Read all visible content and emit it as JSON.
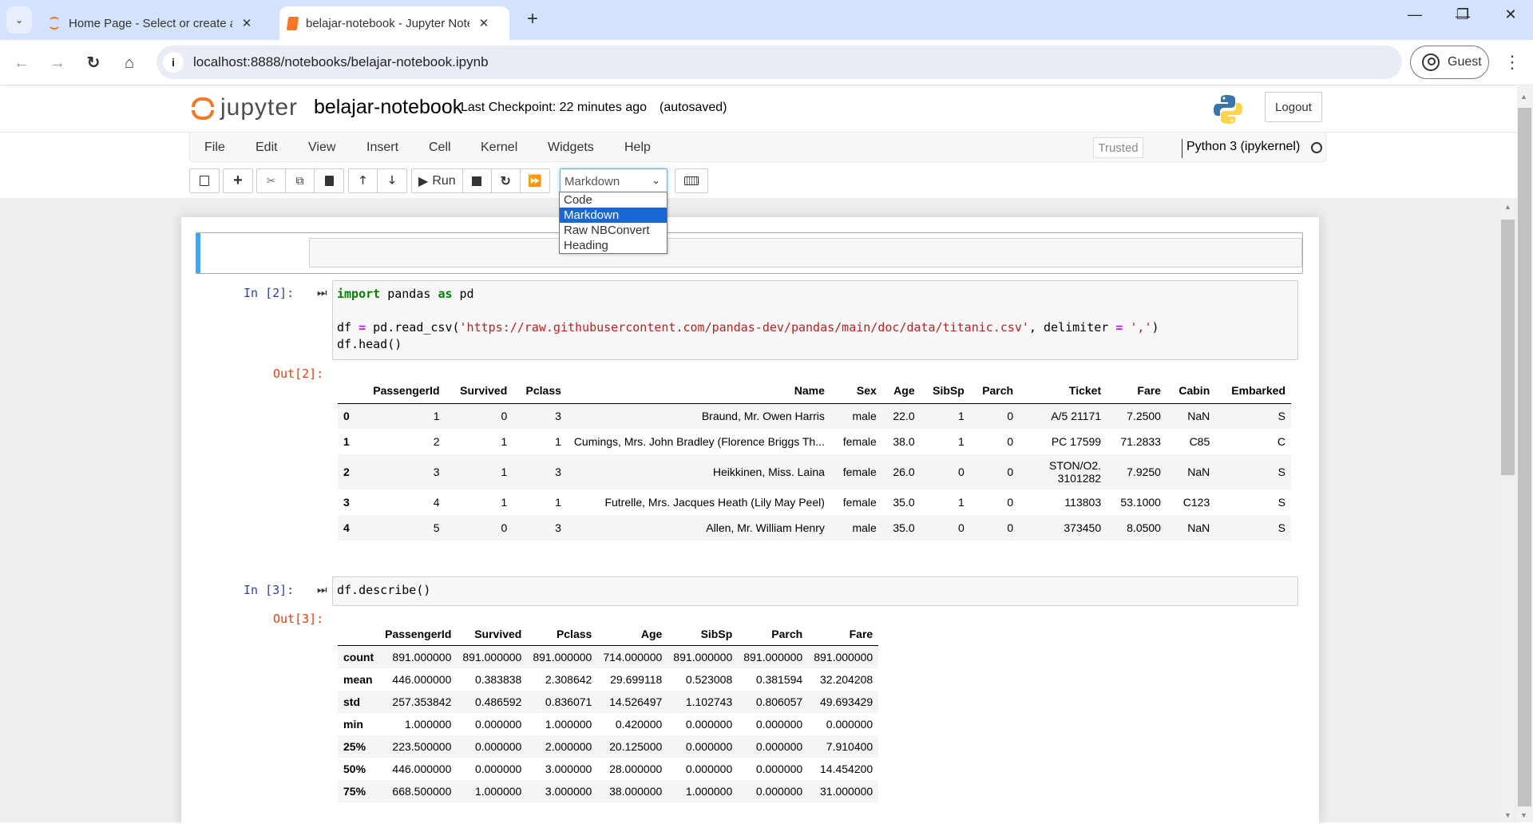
{
  "browser": {
    "tabs": [
      {
        "title": "Home Page - Select or create a notebook",
        "icon": "jupyter-logo-icon",
        "active": false
      },
      {
        "title": "belajar-notebook - Jupyter Notebook",
        "icon": "notebook-icon",
        "active": true
      }
    ],
    "new_tab": "+",
    "url": "localhost:8888/notebooks/belajar-notebook.ipynb",
    "profile_label": "Guest",
    "window_controls": {
      "minimize": "—",
      "restore": "❐",
      "close": "✕"
    }
  },
  "jupyter": {
    "logo_text": "jupyter",
    "notebook_name": "belajar-notebook",
    "checkpoint": "Last Checkpoint: 22 minutes ago",
    "autosave_status": "(autosaved)",
    "logout_label": "Logout",
    "menu": [
      "File",
      "Edit",
      "View",
      "Insert",
      "Cell",
      "Kernel",
      "Widgets",
      "Help"
    ],
    "trusted_label": "Trusted",
    "kernel_name": "Python 3 (ipykernel)",
    "toolbar": {
      "run_label": "Run",
      "cell_type_selected": "Markdown",
      "cell_type_options": [
        "Code",
        "Markdown",
        "Raw NBConvert",
        "Heading"
      ]
    }
  },
  "cells": [
    {
      "type": "markdown",
      "content": ""
    },
    {
      "type": "code",
      "prompt_in": "In [2]:",
      "prompt_out": "Out[2]:",
      "code_line1_kw1": "import",
      "code_line1_mid": " pandas ",
      "code_line1_kw2": "as",
      "code_line1_end": " pd",
      "code_line3_a": "df ",
      "code_line3_eq": "=",
      "code_line3_b": " pd.read_csv(",
      "code_line3_str": "'https://raw.githubusercontent.com/pandas-dev/pandas/main/doc/data/titanic.csv'",
      "code_line3_c": ", delimiter ",
      "code_line3_eq2": "=",
      "code_line3_d": " ",
      "code_line3_str2": "','",
      "code_line3_e": ")",
      "code_line4": "df.head()",
      "table": {
        "columns": [
          "",
          "PassengerId",
          "Survived",
          "Pclass",
          "Name",
          "Sex",
          "Age",
          "SibSp",
          "Parch",
          "Ticket",
          "Fare",
          "Cabin",
          "Embarked"
        ],
        "rows": [
          [
            "0",
            "1",
            "0",
            "3",
            "Braund, Mr. Owen Harris",
            "male",
            "22.0",
            "1",
            "0",
            "A/5 21171",
            "7.2500",
            "NaN",
            "S"
          ],
          [
            "1",
            "2",
            "1",
            "1",
            "Cumings, Mrs. John Bradley (Florence Briggs Th...",
            "female",
            "38.0",
            "1",
            "0",
            "PC 17599",
            "71.2833",
            "C85",
            "C"
          ],
          [
            "2",
            "3",
            "1",
            "3",
            "Heikkinen, Miss. Laina",
            "female",
            "26.0",
            "0",
            "0",
            "STON/O2. 3101282",
            "7.9250",
            "NaN",
            "S"
          ],
          [
            "3",
            "4",
            "1",
            "1",
            "Futrelle, Mrs. Jacques Heath (Lily May Peel)",
            "female",
            "35.0",
            "1",
            "0",
            "113803",
            "53.1000",
            "C123",
            "S"
          ],
          [
            "4",
            "5",
            "0",
            "3",
            "Allen, Mr. William Henry",
            "male",
            "35.0",
            "0",
            "0",
            "373450",
            "8.0500",
            "NaN",
            "S"
          ]
        ]
      }
    },
    {
      "type": "code",
      "prompt_in": "In [3]:",
      "prompt_out": "Out[3]:",
      "code": "df.describe()",
      "table": {
        "columns": [
          "",
          "PassengerId",
          "Survived",
          "Pclass",
          "Age",
          "SibSp",
          "Parch",
          "Fare"
        ],
        "rows": [
          [
            "count",
            "891.000000",
            "891.000000",
            "891.000000",
            "714.000000",
            "891.000000",
            "891.000000",
            "891.000000"
          ],
          [
            "mean",
            "446.000000",
            "0.383838",
            "2.308642",
            "29.699118",
            "0.523008",
            "0.381594",
            "32.204208"
          ],
          [
            "std",
            "257.353842",
            "0.486592",
            "0.836071",
            "14.526497",
            "1.102743",
            "0.806057",
            "49.693429"
          ],
          [
            "min",
            "1.000000",
            "0.000000",
            "1.000000",
            "0.420000",
            "0.000000",
            "0.000000",
            "0.000000"
          ],
          [
            "25%",
            "223.500000",
            "0.000000",
            "2.000000",
            "20.125000",
            "0.000000",
            "0.000000",
            "7.910400"
          ],
          [
            "50%",
            "446.000000",
            "0.000000",
            "3.000000",
            "28.000000",
            "0.000000",
            "0.000000",
            "14.454200"
          ],
          [
            "75%",
            "668.500000",
            "1.000000",
            "3.000000",
            "38.000000",
            "1.000000",
            "0.000000",
            "31.000000"
          ]
        ]
      }
    }
  ]
}
